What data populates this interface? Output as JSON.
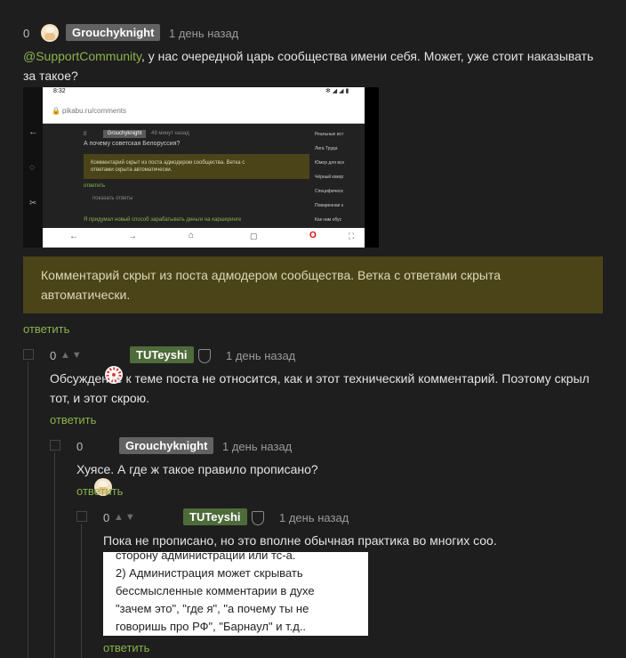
{
  "comment1": {
    "rating": "0",
    "username": "Grouchyknight",
    "time": "1 день назад",
    "mention": "@SupportCommunity",
    "text_after_mention": ", у нас очередной царь сообщества имени себя. Может, уже стоит наказывать",
    "text_line2": "за такое?",
    "hidden_notice": "Комментарий скрыт из поста адмодером сообщества. Ветка с ответами скрыта автоматически.",
    "reply": "ответить"
  },
  "screenshot": {
    "status_time": "8:32",
    "url": "pikabu.ru/comments",
    "inner_user": "Grouchyknight",
    "inner_time": "49 минут назад",
    "inner_text": "А почему советская Белоруссия?",
    "inner_hidden": "Комментарий скрыт из поста адмодером сообщества. Ветка с ответами скрыта автоматически.",
    "inner_reply": "ответить",
    "inner_show": "показать ответы",
    "inner_bottom": "Я придумал новый способ зарабатывать деньги на каршеринге",
    "sidebar": [
      "Реальные ист",
      "Лига Труда",
      "Юмор для все",
      "Чёрный юмор",
      "Специфическ",
      "Поваренная к",
      "Как нам обус"
    ]
  },
  "comment2": {
    "rating": "0",
    "username": "TUTeyshi",
    "time": "1 день назад",
    "text_line1": "Обсуждение к теме поста не относится, как и этот технический комментарий. Поэтому скрыл",
    "text_line2": "тот, и этот скрою.",
    "reply": "ответить"
  },
  "comment3": {
    "rating": "0",
    "username": "Grouchyknight",
    "time": "1 день назад",
    "text": "Хуясе. А где ж такое правило прописано?",
    "reply": "ответить"
  },
  "comment4": {
    "rating": "0",
    "username": "TUTeyshi",
    "time": "1 день назад",
    "text": "Пока не прописано, но это вполне обычная практика во многих соо.",
    "quote_lines": [
      "сторону администрации или тс-а.",
      "2) Администрация может скрывать",
      "бессмысленные комментарии в духе",
      "\"зачем это\", \"где я\", \"а почему ты не",
      "говоришь про РФ\", \"Барнаул\" и т.д.."
    ],
    "reply": "ответить"
  },
  "colors": {
    "background": "#1e1e1e",
    "link": "#8ab24c",
    "hidden_box": "#4a4418",
    "nick_gray": "#626262",
    "nick_green": "#4e6b3a"
  }
}
